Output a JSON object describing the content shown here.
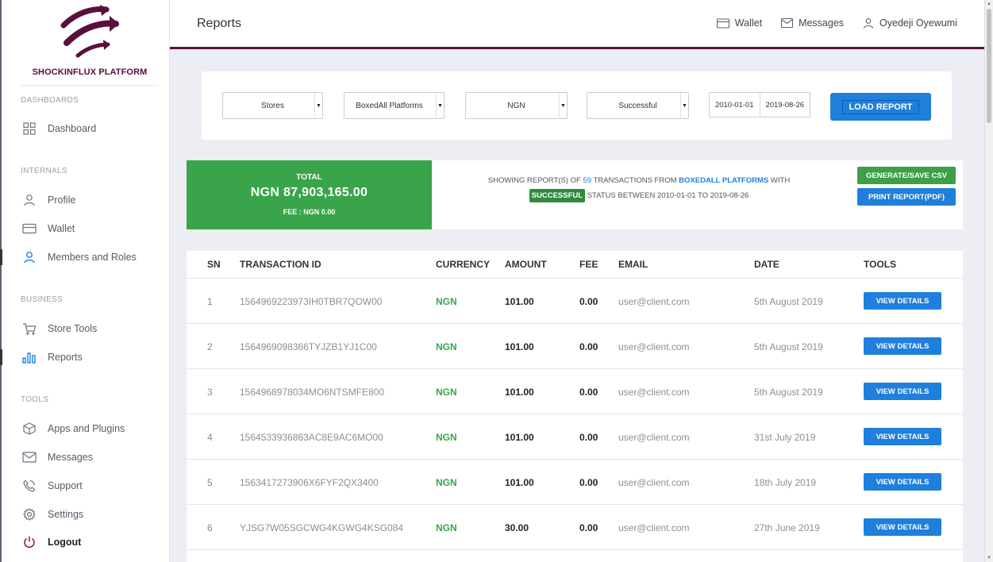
{
  "brand": {
    "name": "SHOCKINFLUX PLATFORM",
    "logo_color": "#5b0f3d"
  },
  "sidebar": {
    "sections": {
      "dashboards": "DASHBOARDS",
      "internals": "INTERNALS",
      "business": "BUSINESS",
      "tools": "TOOLS"
    },
    "items": {
      "dashboard": "Dashboard",
      "profile": "Profile",
      "wallet": "Wallet",
      "members": "Members and Roles",
      "store_tools": "Store Tools",
      "reports": "Reports",
      "apps": "Apps and Plugins",
      "messages": "Messages",
      "support": "Support",
      "settings": "Settings",
      "logout": "Logout"
    }
  },
  "header": {
    "title": "Reports",
    "wallet": "Wallet",
    "messages": "Messages",
    "user": "Oyedeji Oyewumi"
  },
  "filters": {
    "type": "Stores",
    "platform": "BoxedAll Platforms",
    "currency": "NGN",
    "status": "Successful",
    "date_from": "2010-01-01",
    "date_to": "2019-08-26",
    "load_button": "LOAD REPORT"
  },
  "summary": {
    "total_label": "TOTAL",
    "total_amount": "NGN 87,903,165.00",
    "fee": "FEE : NGN 0.00",
    "text_showing": "SHOWING REPORT(S) OF",
    "count": "59",
    "text_transactions_from": "TRANSACTIONS FROM",
    "platform": "BOXEDALL PLATFORMS",
    "text_with": "WITH",
    "status_badge": "SUCCESSFUL",
    "text_status_between": "STATUS BETWEEN 2010-01-01 TO 2019-08-26",
    "csv_button": "GENERATE/SAVE CSV",
    "pdf_button": "PRINT REPORT(PDF)",
    "total_color": "#3aa44a"
  },
  "table": {
    "headers": {
      "sn": "SN",
      "id": "TRANSACTION ID",
      "currency": "CURRENCY",
      "amount": "AMOUNT",
      "fee": "FEE",
      "email": "EMAIL",
      "date": "DATE",
      "tools": "TOOLS"
    },
    "view_label": "VIEW DETAILS",
    "rows": [
      {
        "sn": "1",
        "id": "1564969223973IH0TBR7QOW00",
        "currency": "NGN",
        "amount": "101.00",
        "fee": "0.00",
        "email": "user@client.com",
        "date": "5th August 2019"
      },
      {
        "sn": "2",
        "id": "1564969098366TYJZB1YJ1C00",
        "currency": "NGN",
        "amount": "101.00",
        "fee": "0.00",
        "email": "user@client.com",
        "date": "5th August 2019"
      },
      {
        "sn": "3",
        "id": "1564968978034MO6NTSMFE800",
        "currency": "NGN",
        "amount": "101.00",
        "fee": "0.00",
        "email": "user@client.com",
        "date": "5th August 2019"
      },
      {
        "sn": "4",
        "id": "1564533936863AC8E9AC6MO00",
        "currency": "NGN",
        "amount": "101.00",
        "fee": "0.00",
        "email": "user@client.com",
        "date": "31st July 2019"
      },
      {
        "sn": "5",
        "id": "1563417273906X6FYF2QX3400",
        "currency": "NGN",
        "amount": "101.00",
        "fee": "0.00",
        "email": "user@client.com",
        "date": "18th July 2019"
      },
      {
        "sn": "6",
        "id": "YJSG7W05SGCWG4KGWG4KSG084",
        "currency": "NGN",
        "amount": "30.00",
        "fee": "0.00",
        "email": "user@client.com",
        "date": "27th June 2019"
      }
    ]
  },
  "colors": {
    "accent": "#5b0f3d",
    "primary": "#1f7fdc",
    "success": "#3aa44a"
  }
}
